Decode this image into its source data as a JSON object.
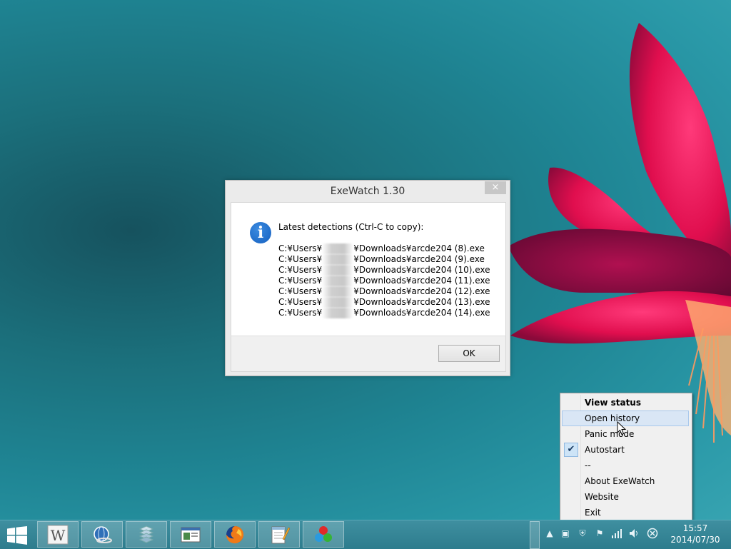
{
  "dialog": {
    "title": "ExeWatch 1.30",
    "close_label": "×",
    "heading": "Latest detections (Ctrl-C to copy):",
    "paths": [
      {
        "prefix": "C:¥Users¥",
        "suffix": "¥Downloads¥arcde204 (8).exe"
      },
      {
        "prefix": "C:¥Users¥",
        "suffix": "¥Downloads¥arcde204 (9).exe"
      },
      {
        "prefix": "C:¥Users¥",
        "suffix": "¥Downloads¥arcde204 (10).exe"
      },
      {
        "prefix": "C:¥Users¥",
        "suffix": "¥Downloads¥arcde204 (11).exe"
      },
      {
        "prefix": "C:¥Users¥",
        "suffix": "¥Downloads¥arcde204 (12).exe"
      },
      {
        "prefix": "C:¥Users¥",
        "suffix": "¥Downloads¥arcde204 (13).exe"
      },
      {
        "prefix": "C:¥Users¥",
        "suffix": "¥Downloads¥arcde204 (14).exe"
      }
    ],
    "ok_label": "OK"
  },
  "menu": {
    "items": [
      {
        "label": "View status",
        "bold": true
      },
      {
        "label": "Open history",
        "hover": true
      },
      {
        "label": "Panic mode"
      },
      {
        "label": "Autostart",
        "checked": true
      },
      {
        "label": "--"
      },
      {
        "label": "About ExeWatch"
      },
      {
        "label": "Website"
      },
      {
        "label": "Exit"
      }
    ]
  },
  "taskbar": {
    "apps": [
      "word-icon",
      "network-globe-icon",
      "stack-app-icon",
      "window-app-icon",
      "firefox-icon",
      "notepad-icon",
      "color-circles-icon"
    ],
    "clock_time": "15:57",
    "clock_date": "2014/07/30"
  },
  "colors": {
    "desktop_teal": "#1f8594",
    "flower_pink": "#e0104f",
    "menu_highlight": "#d9e6f5",
    "info_blue": "#1f6fd0"
  }
}
